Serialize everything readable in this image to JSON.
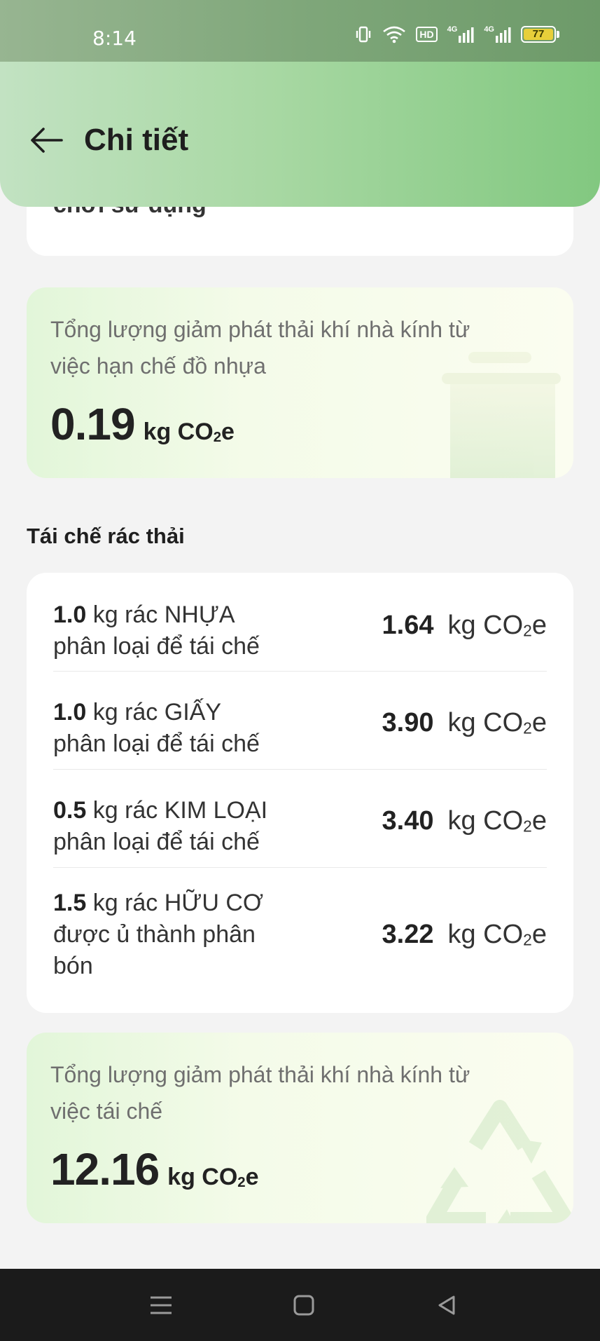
{
  "status": {
    "time": "8:14",
    "battery": "77",
    "hd": "HD",
    "network": "4G"
  },
  "header": {
    "title": "Chi tiết"
  },
  "top_card": {
    "cut_text": "chơi sử dụng"
  },
  "plastic_summary": {
    "label": "Tổng lượng giảm phát thải khí nhà kính từ việc hạn chế đồ nhựa",
    "value": "0.19",
    "unit_main": "kg CO",
    "unit_sub": "2",
    "unit_tail": "e"
  },
  "recycle_section": {
    "title": "Tái chế rác thải"
  },
  "recycle_items": [
    {
      "qty": "1.0",
      "text1": " kg rác NHỰA",
      "text2": "phân loại để tái chế",
      "value": "1.64"
    },
    {
      "qty": "1.0",
      "text1": " kg rác GIẤY",
      "text2": "phân loại để tái chế",
      "value": "3.90"
    },
    {
      "qty": "0.5",
      "text1": " kg rác KIM LOẠI",
      "text2": "phân loại để tái chế",
      "value": "3.40"
    },
    {
      "qty": "1.5",
      "text1": " kg rác HỮU CƠ",
      "text2": "được ủ thành phân bón",
      "value": "3.22"
    }
  ],
  "unit": {
    "main": "kg CO",
    "sub": "2",
    "tail": "e"
  },
  "recycle_summary": {
    "label": "Tổng lượng giảm phát thải khí nhà kính từ việc tái chế",
    "value": "12.16"
  },
  "colors": {
    "header_start": "#c2e2c2",
    "header_end": "#82c880",
    "card_green": "#e2f6d9"
  }
}
